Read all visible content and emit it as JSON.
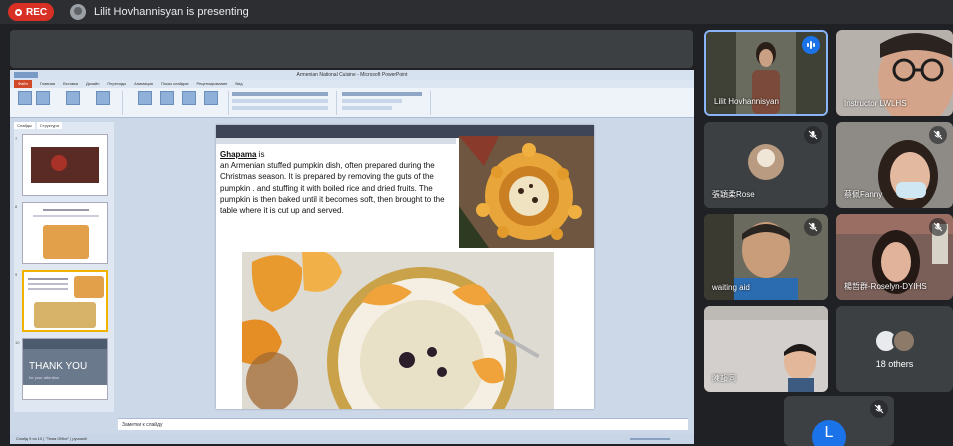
{
  "topbar": {
    "rec_label": "REC",
    "presenting_text": "Lilit Hovhannisyan is presenting"
  },
  "ppt": {
    "window_title": "Armenian National Cuisine - Microsoft PowerPoint",
    "tabs": [
      "Файл",
      "Главная",
      "Вставка",
      "Дизайн",
      "Переходы",
      "Анимация",
      "Показ слайдов",
      "Рецензирование",
      "Вид"
    ],
    "thumb_tabs": [
      "Слайды",
      "Структура"
    ],
    "thumb_numbers": [
      "7",
      "8",
      "9",
      "10"
    ],
    "thank_title": "THANK YOU",
    "thank_sub": "for your attention",
    "notes_placeholder": "Заметки к слайду",
    "status_text": "Слайд 9 из 10   |   \"Тема Office\"   |   русский"
  },
  "slide": {
    "heading": "Ghapama",
    "heading_suffix": " is",
    "body": "an Armenian stuffed pumpkin dish, often prepared during the Christmas season. It is prepared by removing the guts of the pumpkin . and stuffing it with boiled rice and dried fruits. The pumpkin is then baked until it becomes soft, then brought to the table where it is cut up and served."
  },
  "participants": {
    "tile1": "Lilit Hovhannisyan",
    "tile2": "Instructor LWLHS",
    "tile3": "張穎柔Rose",
    "tile4": "蔡佩Fanny",
    "tile5": "waiting aid",
    "tile6": "楊哲群-Roselyn-DYIHS",
    "tile7": "陳韻同",
    "others": "18 others",
    "tile9_initial": "L"
  },
  "colors": {
    "meet_bg": "#202124",
    "rec_red": "#d93025",
    "active_blue": "#8ab4f8",
    "speaking_blue": "#1a73e8"
  }
}
